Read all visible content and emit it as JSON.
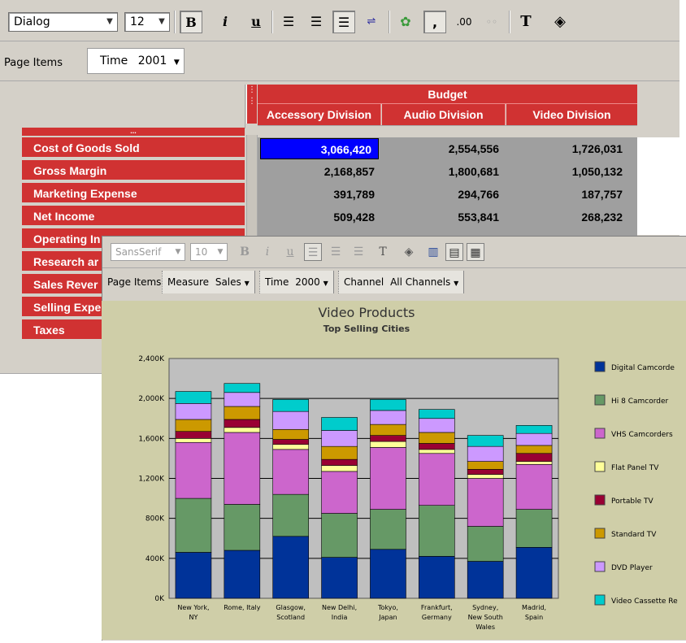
{
  "crosstab": {
    "toolbar": {
      "font_name": "Dialog",
      "font_size": "12",
      "bold": "B",
      "italic": "i",
      "underline": "u",
      "comma": ",",
      "decimal": ".00"
    },
    "page_items_label": "Page Items",
    "page_item": {
      "label": "Time",
      "value": "2001"
    },
    "column_group": "Budget",
    "columns": [
      "Accessory Division",
      "Audio Division",
      "Video Division"
    ],
    "row_header_dots": "...",
    "rows": [
      {
        "label": "Cost of Goods Sold",
        "values": [
          "3,066,420",
          "2,554,556",
          "1,726,031"
        ]
      },
      {
        "label": "Gross Margin",
        "values": [
          "2,168,857",
          "1,800,681",
          "1,050,132"
        ]
      },
      {
        "label": "Marketing Expense",
        "values": [
          "391,789",
          "294,766",
          "187,757"
        ]
      },
      {
        "label": "Net Income",
        "values": [
          "509,428",
          "553,841",
          "268,232"
        ]
      },
      {
        "label": "Operating In",
        "values": [
          "",
          "",
          ""
        ]
      },
      {
        "label": "Research ar",
        "values": [
          "",
          "",
          ""
        ]
      },
      {
        "label": "Sales Rever",
        "values": [
          "",
          "",
          ""
        ]
      },
      {
        "label": "Selling Expe",
        "values": [
          "",
          "",
          ""
        ]
      },
      {
        "label": "Taxes",
        "values": [
          "",
          "",
          ""
        ]
      }
    ],
    "colors": {
      "header_red": "#d03232",
      "selection_blue": "#0000ff",
      "value_bg": "#9f9f9f"
    }
  },
  "graph_window": {
    "toolbar": {
      "font_name": "SansSerif",
      "font_size": "10",
      "bold": "B",
      "italic": "i",
      "underline": "u"
    },
    "page_items_label": "Page Items",
    "page_items": [
      {
        "label": "Measure",
        "value": "Sales"
      },
      {
        "label": "Time",
        "value": "2000"
      },
      {
        "label": "Channel",
        "value": "All Channels"
      }
    ]
  },
  "chart_data": {
    "type": "bar",
    "stacked": true,
    "title": "Video Products",
    "subtitle": "Top Selling Cities",
    "categories": [
      "New York, NY",
      "Rome, Italy",
      "Glasgow, Scotland",
      "New Delhi, India",
      "Tokyo, Japan",
      "Frankfurt, Germany",
      "Sydney, New South Wales",
      "Madrid, Spain"
    ],
    "category_lines": [
      [
        "New York,",
        "NY"
      ],
      [
        "Rome, Italy"
      ],
      [
        "Glasgow,",
        "Scotland"
      ],
      [
        "New Delhi,",
        "India"
      ],
      [
        "Tokyo,",
        "Japan"
      ],
      [
        "Frankfurt,",
        "Germany"
      ],
      [
        "Sydney,",
        "New South",
        "Wales"
      ],
      [
        "Madrid,",
        "Spain"
      ]
    ],
    "yticks": [
      "0K",
      "400K",
      "800K",
      "1,200K",
      "1,600K",
      "2,000K",
      "2,400K"
    ],
    "ylim": [
      0,
      2400000
    ],
    "grid": true,
    "legend_position": "right",
    "plot_background": "#bfbfbf",
    "series": [
      {
        "name": "Digital Camcorder",
        "color": "#003399",
        "values": [
          460000,
          480000,
          620000,
          410000,
          490000,
          420000,
          370000,
          510000
        ]
      },
      {
        "name": "Hi 8 Camcorder",
        "color": "#669966",
        "values": [
          540000,
          460000,
          420000,
          440000,
          400000,
          510000,
          350000,
          380000
        ]
      },
      {
        "name": "VHS Camcorders",
        "color": "#cc66cc",
        "values": [
          560000,
          720000,
          450000,
          420000,
          620000,
          520000,
          480000,
          450000
        ]
      },
      {
        "name": "Flat Panel TV",
        "color": "#ffff99",
        "values": [
          40000,
          50000,
          50000,
          60000,
          60000,
          40000,
          40000,
          30000
        ]
      },
      {
        "name": "Portable TV",
        "color": "#990033",
        "values": [
          70000,
          80000,
          50000,
          60000,
          60000,
          60000,
          50000,
          80000
        ]
      },
      {
        "name": "Standard TV",
        "color": "#cc9900",
        "values": [
          120000,
          130000,
          100000,
          130000,
          110000,
          110000,
          80000,
          80000
        ]
      },
      {
        "name": "DVD Player",
        "color": "#cc99ff",
        "values": [
          160000,
          140000,
          180000,
          160000,
          140000,
          140000,
          150000,
          120000
        ]
      },
      {
        "name": "Video Cassette Recorder",
        "color": "#00cccc",
        "values": [
          120000,
          90000,
          120000,
          130000,
          110000,
          90000,
          110000,
          80000
        ]
      }
    ],
    "legend_labels": [
      "Digital Camcorde",
      "Hi 8 Camcorder",
      "VHS Camcorders",
      "Flat Panel TV",
      "Portable TV",
      "Standard TV",
      "DVD Player",
      "Video Cassette Re"
    ]
  }
}
